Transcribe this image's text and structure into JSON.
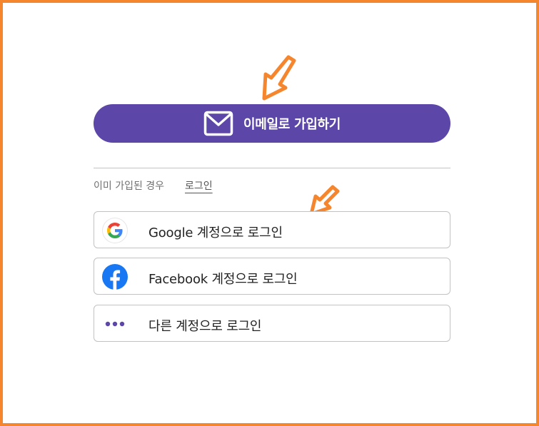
{
  "signup": {
    "email_label": "이메일로 가입하기"
  },
  "login_prompt": {
    "text": "이미 가입된 경우",
    "link": "로그인"
  },
  "social_buttons": [
    {
      "label": "Google 계정으로 로그인",
      "icon": "google-icon"
    },
    {
      "label": "Facebook 계정으로 로그인",
      "icon": "facebook-icon"
    },
    {
      "label": "다른 계정으로 로그인",
      "icon": "more-dots-icon"
    }
  ],
  "colors": {
    "primary": "#5c46a8",
    "annotation": "#f5862e",
    "facebook": "#1877f2"
  }
}
